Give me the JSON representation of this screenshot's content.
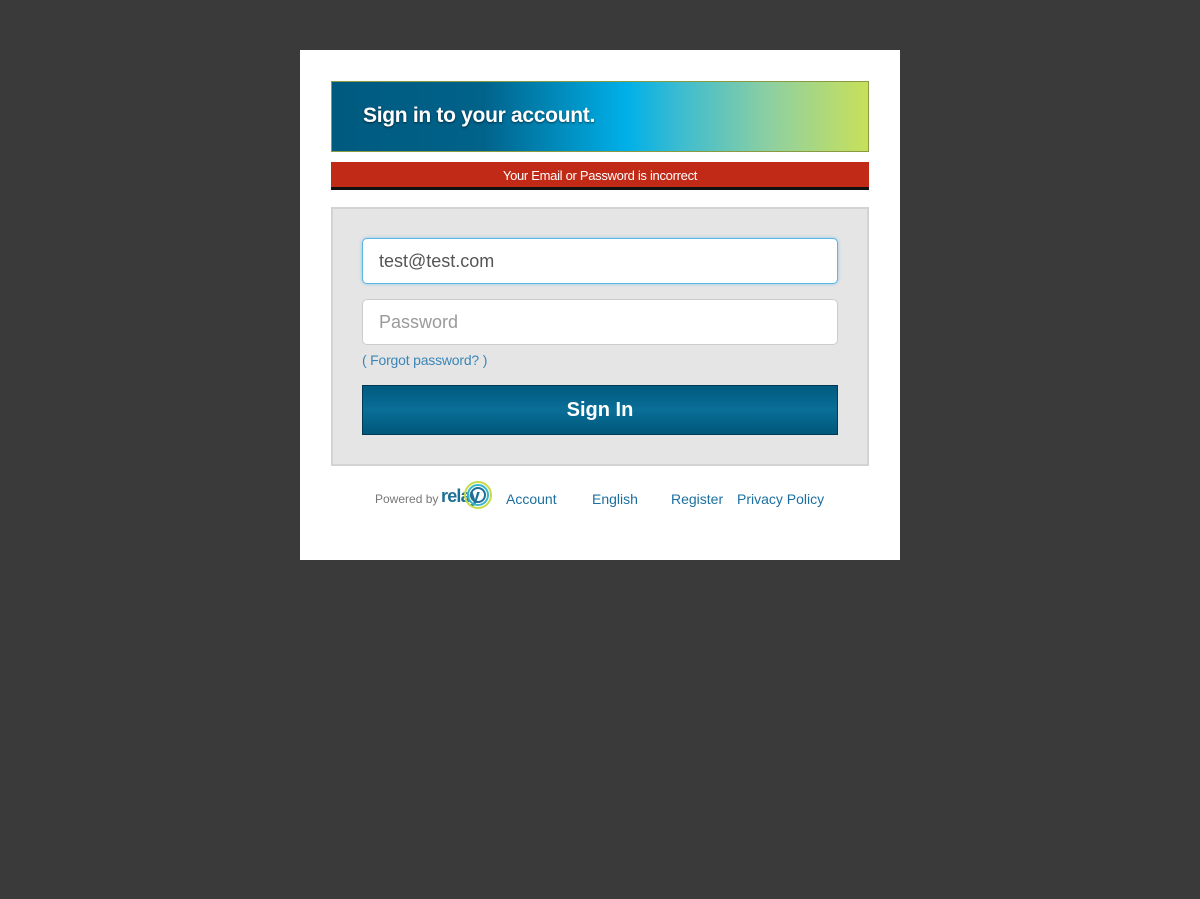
{
  "banner": {
    "title": "Sign in to your account."
  },
  "error": {
    "message": "Your Email or Password is incorrect"
  },
  "form": {
    "email_value": "test@test.com",
    "password_placeholder": "Password",
    "forgot_label": "( Forgot password? )",
    "signin_label": "Sign In"
  },
  "footer": {
    "powered_by": "Powered by",
    "brand_name": "relay",
    "links": {
      "account": "Account",
      "language": "English",
      "register": "Register",
      "privacy": "Privacy Policy"
    }
  },
  "colors": {
    "background": "#3a3a3a",
    "error": "#c02a16",
    "button": "#005a80",
    "link": "#1b6fa0"
  }
}
